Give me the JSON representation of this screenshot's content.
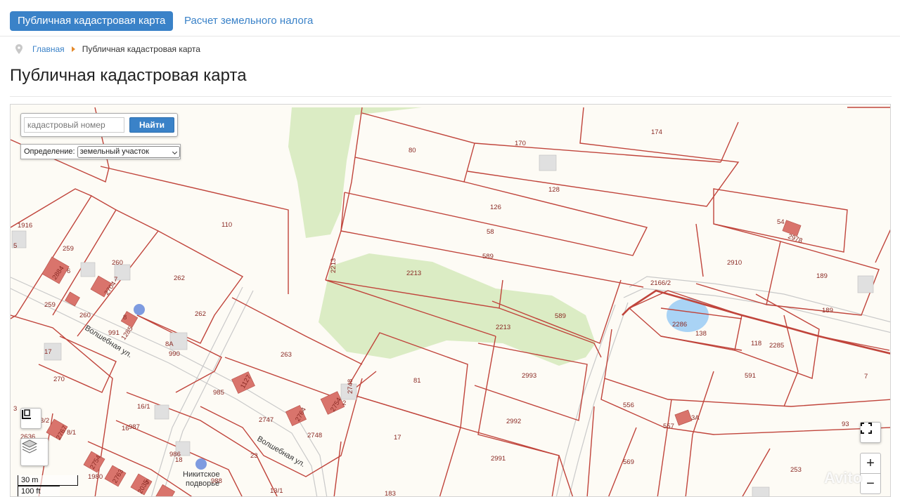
{
  "topnav": {
    "active_tab": "Публичная кадастровая карта",
    "link_tab": "Расчет земельного налога"
  },
  "breadcrumb": {
    "home": "Главная",
    "current": "Публичная кадастровая карта"
  },
  "page_title": "Публичная кадастровая карта",
  "map": {
    "search": {
      "placeholder": "кадастровый номер",
      "button": "Найти"
    },
    "definition": {
      "label": "Определение:",
      "selected": "земельный участок"
    },
    "scale": {
      "metric": "30 m",
      "imperial": "100 ft"
    },
    "zoom_in": "+",
    "zoom_out": "−",
    "streets": [
      "Волшебная ул.",
      "Волшебная ул."
    ],
    "poi": [
      "Никитское",
      "подворье"
    ],
    "plot_labels": [
      "1916",
      "5",
      "259",
      "260",
      "2884",
      "6",
      "7",
      "2704",
      "262",
      "259",
      "260",
      "991",
      "1285",
      "8",
      "8А",
      "990",
      "262",
      "110",
      "170",
      "174",
      "80",
      "128",
      "126",
      "58",
      "589",
      "2213",
      "2213",
      "2213",
      "589",
      "54",
      "2978",
      "2910",
      "189",
      "2166/2",
      "189",
      "2286",
      "138",
      "118",
      "2285",
      "591",
      "7",
      "17",
      "270",
      "263",
      "985",
      "1127",
      "2747",
      "2748",
      "2748",
      "2764",
      "2754",
      "2",
      "81",
      "2993",
      "2992",
      "17",
      "2991",
      "556",
      "557",
      "3А",
      "93",
      "569",
      "253",
      "183",
      "23",
      "13/1",
      "16/1",
      "16",
      "987",
      "986",
      "18",
      "1980",
      "2754",
      "2763",
      "2035",
      "5",
      "988",
      "3/2",
      "2636",
      "3",
      "8/1",
      "2767"
    ],
    "watermark": "Avito",
    "colors": {
      "boundary": "#c0443b",
      "building": "#d9746c",
      "green_area": "#dbecc4",
      "water": "#a9d3f5"
    }
  }
}
